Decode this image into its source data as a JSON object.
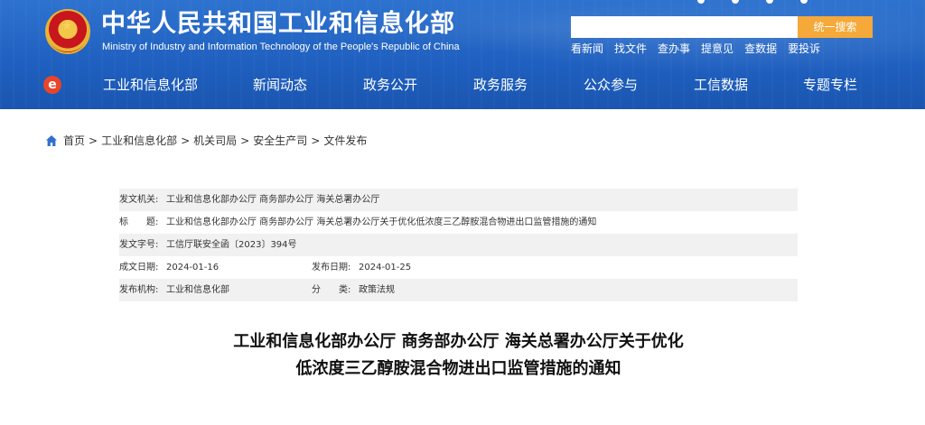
{
  "header": {
    "title": "中华人民共和国工业和信息化部",
    "subtitle": "Ministry of Industry and Information Technology of the People's Republic of China",
    "search": {
      "placeholder": "",
      "button_label": "统一搜索"
    },
    "quick_links": [
      "看新闻",
      "找文件",
      "查办事",
      "提意见",
      "查数据",
      "要投诉"
    ]
  },
  "nav": {
    "logo_glyph": "e",
    "items": [
      "工业和信息化部",
      "新闻动态",
      "政务公开",
      "政务服务",
      "公众参与",
      "工信数据",
      "专题专栏"
    ]
  },
  "breadcrumb": [
    "首页",
    "工业和信息化部",
    "机关司局",
    "安全生产司",
    "文件发布"
  ],
  "breadcrumb_separator": ">",
  "meta": {
    "issuer_label": "发文机关:",
    "issuer": "工业和信息化部办公厅 商务部办公厅 海关总署办公厅",
    "title_label": "标　　题:",
    "title": "工业和信息化部办公厅 商务部办公厅 海关总署办公厅关于优化低浓度三乙醇胺混合物进出口监管措施的通知",
    "doc_number_label": "发文字号:",
    "doc_number": "工信厅联安全函〔2023〕394号",
    "written_date_label": "成文日期:",
    "written_date": "2024-01-16",
    "publish_date_label": "发布日期:",
    "publish_date": "2024-01-25",
    "publisher_label": "发布机构:",
    "publisher": "工业和信息化部",
    "category_label": "分　　类:",
    "category": "政策法规"
  },
  "document": {
    "title_line1": "工业和信息化部办公厅 商务部办公厅 海关总署办公厅关于优化",
    "title_line2": "低浓度三乙醇胺混合物进出口监管措施的通知"
  },
  "colors": {
    "header_blue": "#1f5fbf",
    "search_button": "#f4a93a",
    "home_icon": "#2f6fd0",
    "row_shade": "#f1f1f1"
  }
}
